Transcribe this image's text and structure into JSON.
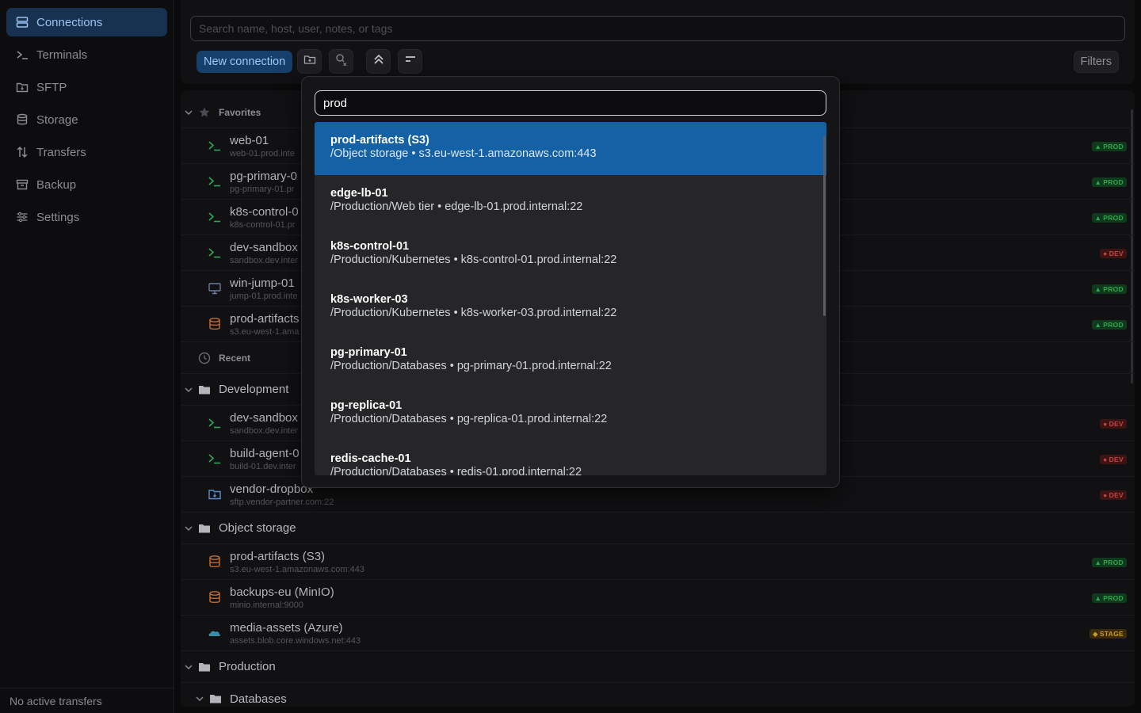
{
  "sidebar": {
    "items": [
      {
        "label": "Connections",
        "icon": "server-icon"
      },
      {
        "label": "Terminals",
        "icon": "terminal-icon"
      },
      {
        "label": "SFTP",
        "icon": "folder-transfer-icon"
      },
      {
        "label": "Storage",
        "icon": "database-icon"
      },
      {
        "label": "Transfers",
        "icon": "transfer-arrows-icon"
      },
      {
        "label": "Backup",
        "icon": "archive-icon"
      },
      {
        "label": "Settings",
        "icon": "sliders-icon"
      }
    ],
    "footer": "No active transfers"
  },
  "toolbar": {
    "search_placeholder": "Search name, host, user, notes, or tags",
    "new_connection": "New connection",
    "filters": "Filters"
  },
  "list": {
    "favorites_label": "Favorites",
    "recent_label": "Recent",
    "favorites": [
      {
        "name": "web-01",
        "host": "web-01.prod.inte",
        "badge": "PROD",
        "icon": "terminal-icon"
      },
      {
        "name": "pg-primary-0",
        "host": "pg-primary-01.pr",
        "badge": "PROD",
        "icon": "terminal-icon"
      },
      {
        "name": "k8s-control-0",
        "host": "k8s-control-01.pr",
        "badge": "PROD",
        "icon": "terminal-icon"
      },
      {
        "name": "dev-sandbox",
        "host": "sandbox.dev.inter",
        "badge": "DEV",
        "icon": "terminal-icon"
      },
      {
        "name": "win-jump-01",
        "host": "jump-01.prod.inte",
        "badge": "PROD",
        "icon": "monitor-icon"
      },
      {
        "name": "prod-artifacts",
        "host": "s3.eu-west-1.ama",
        "badge": "PROD",
        "icon": "database-icon"
      }
    ],
    "development_label": "Development",
    "development": [
      {
        "name": "dev-sandbox",
        "host": "sandbox.dev.inter",
        "badge": "DEV",
        "icon": "terminal-icon"
      },
      {
        "name": "build-agent-0",
        "host": "build-01.dev.inter",
        "badge": "DEV",
        "icon": "terminal-icon"
      },
      {
        "name": "vendor-dropbox",
        "host": "sftp.vendor-partner.com:22",
        "badge": "DEV",
        "icon": "folder-transfer-icon"
      }
    ],
    "object_storage_label": "Object storage",
    "object_storage": [
      {
        "name": "prod-artifacts (S3)",
        "host": "s3.eu-west-1.amazonaws.com:443",
        "badge": "PROD",
        "icon": "database-icon"
      },
      {
        "name": "backups-eu (MinIO)",
        "host": "minio.internal:9000",
        "badge": "PROD",
        "icon": "database-icon"
      },
      {
        "name": "media-assets (Azure)",
        "host": "assets.blob.core.windows.net:443",
        "badge": "STAGE",
        "icon": "cloud-icon"
      }
    ],
    "production_label": "Production",
    "databases_label": "Databases"
  },
  "badge_colors": {
    "PROD": "#2fa752",
    "DEV": "#c24444",
    "STAGE": "#c99a27"
  },
  "popup": {
    "query": "prod",
    "results": [
      {
        "title": "prod-artifacts (S3)",
        "sub": "/Object storage • s3.eu-west-1.amazonaws.com:443"
      },
      {
        "title": "edge-lb-01",
        "sub": "/Production/Web tier • edge-lb-01.prod.internal:22"
      },
      {
        "title": "k8s-control-01",
        "sub": "/Production/Kubernetes • k8s-control-01.prod.internal:22"
      },
      {
        "title": "k8s-worker-03",
        "sub": "/Production/Kubernetes • k8s-worker-03.prod.internal:22"
      },
      {
        "title": "pg-primary-01",
        "sub": "/Production/Databases • pg-primary-01.prod.internal:22"
      },
      {
        "title": "pg-replica-01",
        "sub": "/Production/Databases • pg-replica-01.prod.internal:22"
      },
      {
        "title": "redis-cache-01",
        "sub": "/Production/Databases • redis-01.prod.internal:22"
      }
    ]
  }
}
